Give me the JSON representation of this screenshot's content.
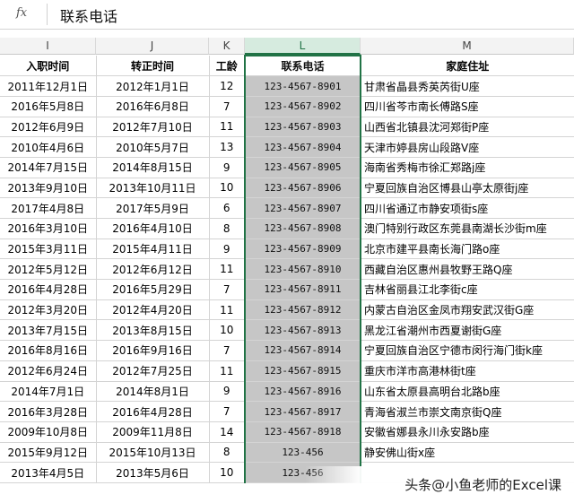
{
  "formula_bar": {
    "fx_label": "fx",
    "value": "联系电话"
  },
  "columns": [
    "I",
    "J",
    "K",
    "L",
    "M"
  ],
  "selected_column": "L",
  "headers": [
    "入职时间",
    "转正时间",
    "工龄",
    "联系电话",
    "家庭住址"
  ],
  "rows": [
    [
      "2011年12月1日",
      "2012年1月1日",
      "12",
      "123-4567-8901",
      "甘肃省晶县秀英芮街U座"
    ],
    [
      "2016年5月8日",
      "2016年6月8日",
      "7",
      "123-4567-8902",
      "四川省芩市南长傅路S座"
    ],
    [
      "2012年6月9日",
      "2012年7月10日",
      "11",
      "123-4567-8903",
      "山西省北镇县沈河郑街P座"
    ],
    [
      "2010年4月6日",
      "2010年5月7日",
      "13",
      "123-4567-8904",
      "天津市婷县房山段路V座"
    ],
    [
      "2014年7月15日",
      "2014年8月15日",
      "9",
      "123-4567-8905",
      "海南省秀梅市徐汇郑路j座"
    ],
    [
      "2013年9月10日",
      "2013年10月11日",
      "10",
      "123-4567-8906",
      "宁夏回族自治区博县山亭太原街j座"
    ],
    [
      "2017年4月8日",
      "2017年5月9日",
      "6",
      "123-4567-8907",
      "四川省通辽市静安项街s座"
    ],
    [
      "2016年3月10日",
      "2016年4月10日",
      "8",
      "123-4567-8908",
      "澳门特别行政区东莞县南湖长沙街m座"
    ],
    [
      "2015年3月11日",
      "2015年4月11日",
      "9",
      "123-4567-8909",
      "北京市建平县南长海门路o座"
    ],
    [
      "2012年5月12日",
      "2012年6月12日",
      "11",
      "123-4567-8910",
      "西藏自治区惠州县牧野王路Q座"
    ],
    [
      "2016年4月28日",
      "2016年5月29日",
      "7",
      "123-4567-8911",
      "吉林省丽县江北李街c座"
    ],
    [
      "2012年3月20日",
      "2012年4月20日",
      "11",
      "123-4567-8912",
      "内蒙古自治区金凤市翔安武汉街G座"
    ],
    [
      "2013年7月15日",
      "2013年8月15日",
      "10",
      "123-4567-8913",
      "黑龙江省潮州市西夏谢街G座"
    ],
    [
      "2016年8月16日",
      "2016年9月16日",
      "7",
      "123-4567-8914",
      "宁夏回族自治区宁德市闵行海门街k座"
    ],
    [
      "2012年6月24日",
      "2012年7月25日",
      "11",
      "123-4567-8915",
      "重庆市洋市高港林街t座"
    ],
    [
      "2014年7月1日",
      "2014年8月1日",
      "9",
      "123-4567-8916",
      "山东省太原县高明台北路b座"
    ],
    [
      "2016年3月28日",
      "2016年4月28日",
      "7",
      "123-4567-8917",
      "青海省淑兰市崇文南京街Q座"
    ],
    [
      "2009年10月8日",
      "2009年11月8日",
      "14",
      "123-4567-8918",
      "安徽省娜县永川永安路b座"
    ],
    [
      "2015年9月12日",
      "2015年10月13日",
      "8",
      "123-456",
      "静安佛山街x座"
    ],
    [
      "2013年4月5日",
      "2013年5月6日",
      "10",
      "123-456",
      ""
    ]
  ],
  "watermark": "头条@小鱼老师的Excel课"
}
